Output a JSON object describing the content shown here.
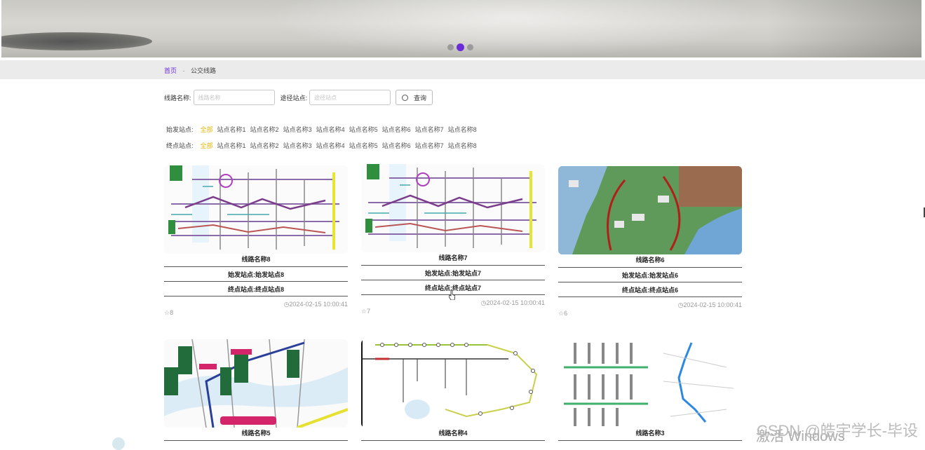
{
  "banner": {
    "dots": 3,
    "active_dot": 1
  },
  "breadcrumb": {
    "home": "首页",
    "separator": "-",
    "current": "公交线路"
  },
  "search": {
    "route_label": "线路名称:",
    "route_placeholder": "线路名称",
    "station_label": "途径站点:",
    "station_placeholder": "途径站点",
    "button_label": "查询"
  },
  "filters": {
    "start": {
      "label": "始发站点:",
      "options": [
        "全部",
        "站点名称1",
        "站点名称2",
        "站点名称3",
        "站点名称4",
        "站点名称5",
        "站点名称6",
        "站点名称7",
        "站点名称8"
      ]
    },
    "end": {
      "label": "终点站点:",
      "options": [
        "全部",
        "站点名称1",
        "站点名称2",
        "站点名称3",
        "站点名称4",
        "站点名称5",
        "站点名称6",
        "站点名称7",
        "站点名称8"
      ]
    }
  },
  "cards": [
    {
      "name": "线路名称8",
      "start": "始发站点:始发站点8",
      "end": "终点站点:终点站点8",
      "time": "2024-02-15 10:00:41",
      "likes": "8"
    },
    {
      "name": "线路名称7",
      "start": "始发站点:始发站点7",
      "end": "终点站点:终点站点7",
      "time": "2024-02-15 10:00:41",
      "likes": "7"
    },
    {
      "name": "线路名称6",
      "start": "始发站点:始发站点6",
      "end": "终点站点:终点站点6",
      "time": "2024-02-15 10:00:41",
      "likes": "6"
    },
    {
      "name": "线路名称5"
    },
    {
      "name": "线路名称4"
    },
    {
      "name": "线路名称3"
    }
  ],
  "overlay": {
    "watermark": "CSDN @皓宇学长-毕设",
    "activate": "激活 Windows"
  },
  "colors": {
    "accent": "#6a2cd8",
    "active_filter": "#e5b700"
  }
}
